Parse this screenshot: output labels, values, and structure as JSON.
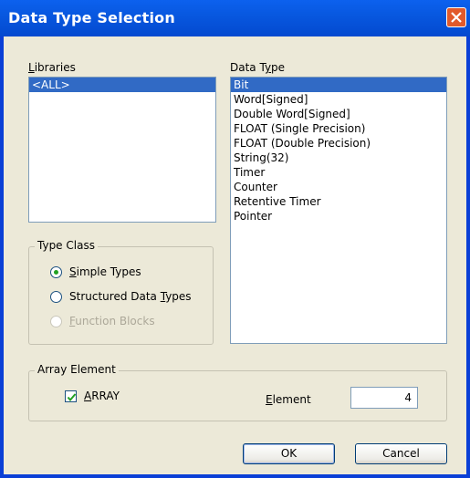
{
  "window": {
    "title": "Data Type Selection"
  },
  "libraries": {
    "label_pre": "",
    "label_u": "L",
    "label_post": "ibraries",
    "items": [
      {
        "label": "<ALL>",
        "selected": true
      }
    ]
  },
  "data_type": {
    "label_pre": "Data T",
    "label_u": "y",
    "label_post": "pe",
    "items": [
      {
        "label": "Bit",
        "selected": true
      },
      {
        "label": "Word[Signed]"
      },
      {
        "label": "Double Word[Signed]"
      },
      {
        "label": "FLOAT (Single Precision)"
      },
      {
        "label": "FLOAT (Double Precision)"
      },
      {
        "label": "String(32)"
      },
      {
        "label": "Timer"
      },
      {
        "label": "Counter"
      },
      {
        "label": "Retentive Timer"
      },
      {
        "label": "Pointer"
      }
    ]
  },
  "type_class": {
    "title": "Type Class",
    "options": [
      {
        "pre": "",
        "u": "S",
        "post": "imple Types",
        "checked": true,
        "enabled": true
      },
      {
        "pre": "Structured Data ",
        "u": "T",
        "post": "ypes",
        "checked": false,
        "enabled": true
      },
      {
        "pre": "",
        "u": "F",
        "post": "unction Blocks",
        "checked": false,
        "enabled": false
      }
    ]
  },
  "array_element": {
    "title": "Array Element",
    "checkbox_u": "A",
    "checkbox_post": "RRAY",
    "checked": true,
    "element_u": "E",
    "element_post": "lement",
    "element_value": "4"
  },
  "buttons": {
    "ok": "OK",
    "cancel": "Cancel"
  }
}
